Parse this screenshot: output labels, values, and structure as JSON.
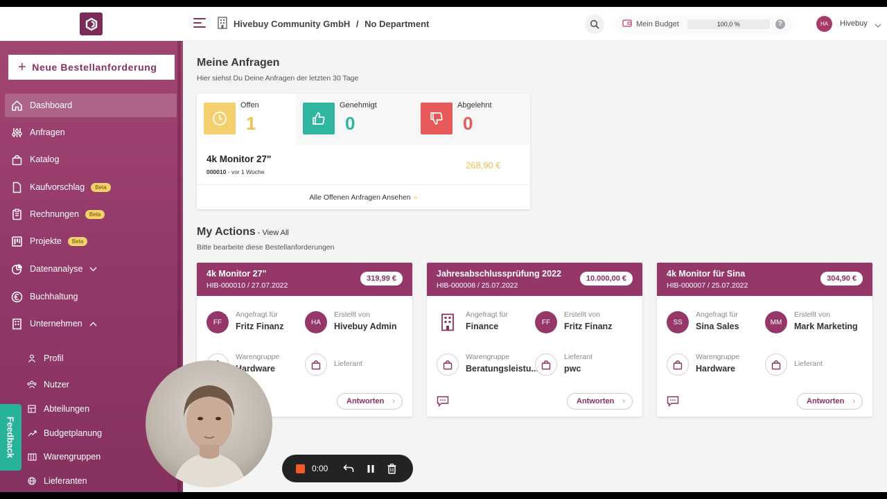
{
  "header": {
    "company": "Hivebuy Community GmbH",
    "separator": "/",
    "department": "No Department",
    "budget_label": "Mein Budget",
    "budget_value": "100,0 %",
    "help": "?",
    "user_initials": "HA",
    "user_name": "Hivebuy"
  },
  "sidebar": {
    "new_button": "Neue Bestellanforderung",
    "items": [
      {
        "label": "Dashboard",
        "icon": "home-icon"
      },
      {
        "label": "Anfragen",
        "icon": "sliders-icon"
      },
      {
        "label": "Katalog",
        "icon": "shopping-bag-icon"
      },
      {
        "label": "Kaufvorschlag",
        "icon": "document-icon",
        "badge": "Beta"
      },
      {
        "label": "Rechnungen",
        "icon": "clipboard-icon",
        "badge": "Beta"
      },
      {
        "label": "Projekte",
        "icon": "kanban-icon",
        "badge": "Beta"
      },
      {
        "label": "Datenanalyse",
        "icon": "pie-chart-icon"
      },
      {
        "label": "Buchhaltung",
        "icon": "euro-icon"
      },
      {
        "label": "Unternehmen",
        "icon": "building-icon"
      }
    ],
    "subitems": [
      {
        "label": "Profil",
        "icon": "user-icon"
      },
      {
        "label": "Nutzer",
        "icon": "users-icon"
      },
      {
        "label": "Abteilungen",
        "icon": "departments-icon"
      },
      {
        "label": "Budgetplanung",
        "icon": "trend-icon"
      },
      {
        "label": "Warengruppen",
        "icon": "columns-icon"
      },
      {
        "label": "Lieferanten",
        "icon": "globe-icon"
      }
    ],
    "feedback": "Feedback"
  },
  "requests": {
    "title": "Meine Anfragen",
    "subtitle": "Hier siehst Du Deine Anfragen der letzten 30 Tage",
    "stats": [
      {
        "label": "Offen",
        "value": "1",
        "color": "#f3cf6e",
        "num_color": "#f0c14b",
        "icon": "clock-icon"
      },
      {
        "label": "Genehmigt",
        "value": "0",
        "color": "#2fb5a0",
        "num_color": "#2fb5a0",
        "icon": "thumbs-up-icon"
      },
      {
        "label": "Abgelehnt",
        "value": "0",
        "color": "#e85a5a",
        "num_color": "#e85a5a",
        "icon": "thumbs-down-icon"
      }
    ],
    "item": {
      "title": "4k Monitor 27\"",
      "id": "000010",
      "meta": " - vor 1 Woche",
      "price": "268,90 €"
    },
    "link": "Alle Offenen Anfragen Ansehen",
    "link_arrow": "»"
  },
  "actions": {
    "title": "My Actions",
    "view_all": " - View All",
    "subtitle": "Bitte bearbeite diese Bestellanforderungen",
    "requested_for_label": "Angefragt für",
    "created_by_label": "Erstellt von",
    "category_label": "Warengruppe",
    "supplier_label": "Lieferant",
    "reply_label": "Antworten",
    "cards": [
      {
        "title": "4k Monitor 27\"",
        "sub": "HIB-000010 / 27.07.2022",
        "price": "319,99 €",
        "req_initials": "FF",
        "req_name": "Fritz Finanz",
        "cr_initials": "HA",
        "cr_name": "Hivebuy Admin",
        "category": "Hardware",
        "supplier": ""
      },
      {
        "title": "Jahresabschlussprüfung 2022",
        "sub": "HIB-000008 / 25.07.2022",
        "price": "10.000,00 €",
        "req_initials": "",
        "req_name": "Finance",
        "cr_initials": "FF",
        "cr_name": "Fritz Finanz",
        "category": "Beratungsleistu...",
        "supplier": "pwc"
      },
      {
        "title": "4k Monitor für Sina",
        "sub": "HIB-000007 / 25.07.2022",
        "price": "304,90 €",
        "req_initials": "SS",
        "req_name": "Sina Sales",
        "cr_initials": "MM",
        "cr_name": "Mark Marketing",
        "category": "Hardware",
        "supplier": ""
      }
    ]
  },
  "recorder": {
    "time": "0:00"
  }
}
